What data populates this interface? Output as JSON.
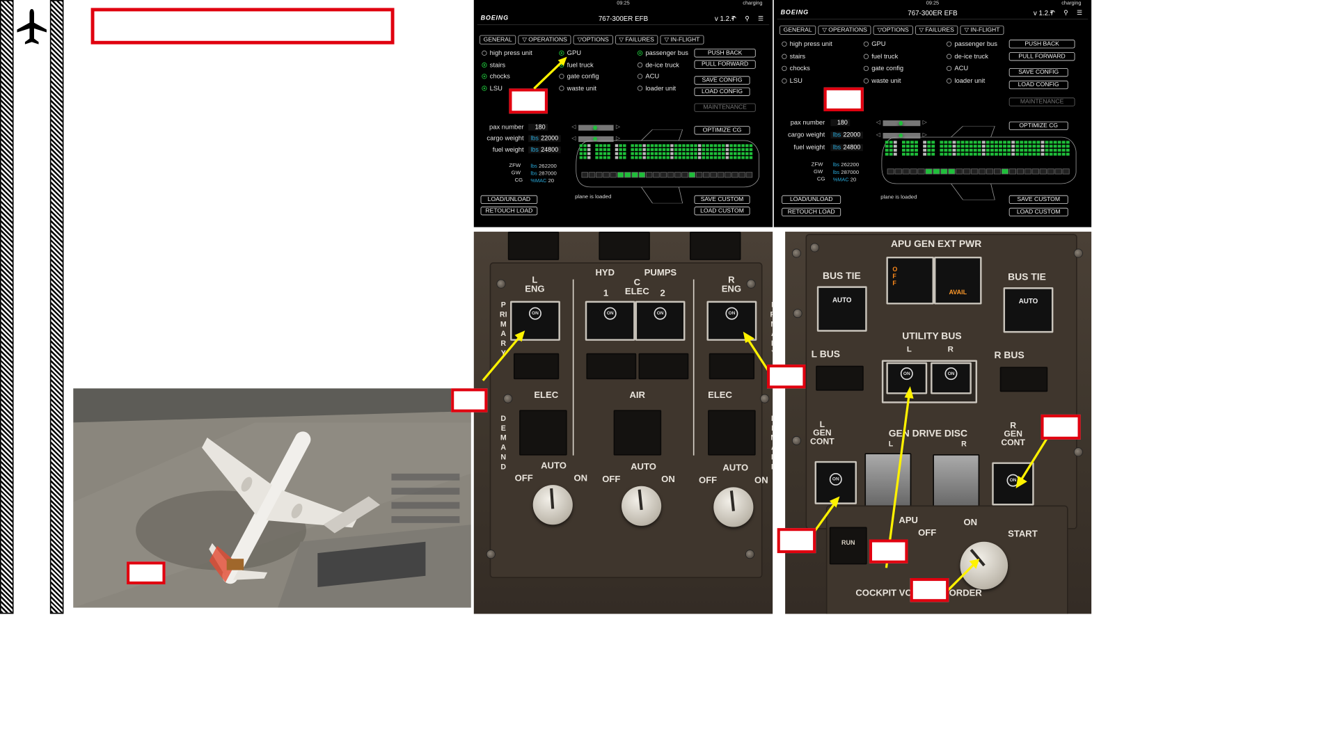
{
  "sidebar": {
    "icon": "airplane-icon"
  },
  "efb_left": {
    "time": "09:25",
    "charging": "charging",
    "logo": "BOEING",
    "title": "767-300ER EFB",
    "version": "v 1.2.7",
    "tabs": [
      "GENERAL",
      "▽ OPERATIONS",
      "▽OPTIONS",
      "▽ FAILURES",
      "▽ IN-FLIGHT"
    ],
    "col1": [
      {
        "label": "high press unit",
        "on": false
      },
      {
        "label": "stairs",
        "on": true
      },
      {
        "label": "chocks",
        "on": true
      },
      {
        "label": "LSU",
        "on": true
      }
    ],
    "col2": [
      {
        "label": "GPU",
        "on": true
      },
      {
        "label": "fuel truck",
        "on": true
      },
      {
        "label": "gate config",
        "on": false
      },
      {
        "label": "waste unit",
        "on": false
      }
    ],
    "col3": [
      {
        "label": "passenger bus",
        "on": true
      },
      {
        "label": "de-ice truck",
        "on": false
      },
      {
        "label": "ACU",
        "on": false
      },
      {
        "label": "loader unit",
        "on": false
      }
    ],
    "buttons": {
      "push_back": "PUSH BACK",
      "pull_forward": "PULL FORWARD",
      "save_config": "SAVE CONFIG",
      "load_config": "LOAD CONFIG",
      "maintenance": "MAINTENANCE",
      "optimize_cg": "OPTIMIZE CG",
      "load_unload": "LOAD/UNLOAD",
      "retouch_load": "RETOUCH LOAD",
      "save_custom": "SAVE CUSTOM",
      "load_custom": "LOAD CUSTOM"
    },
    "pax_label": "pax number",
    "pax_value": "180",
    "cargo_label": "cargo weight",
    "cargo_unit": "lbs",
    "cargo_value": "22000",
    "fuel_label": "fuel weight",
    "fuel_unit": "lbs",
    "fuel_value": "24800",
    "zfw_label": "ZFW",
    "zfw_unit": "lbs",
    "zfw_value": "262200",
    "gw_label": "GW",
    "gw_unit": "lbs",
    "gw_value": "287000",
    "cg_label": "CG",
    "cg_unit": "%MAC",
    "cg_value": "20",
    "plane_status": "plane is loaded"
  },
  "efb_right": {
    "time": "09:25",
    "charging": "charging",
    "logo": "BOEING",
    "title": "767-300ER EFB",
    "version": "v 1.2.7",
    "tabs": [
      "GENERAL",
      "▽ OPERATIONS",
      "▽OPTIONS",
      "▽ FAILURES",
      "▽ IN-FLIGHT"
    ],
    "col1": [
      {
        "label": "high press unit",
        "on": false
      },
      {
        "label": "stairs",
        "on": false
      },
      {
        "label": "chocks",
        "on": false
      },
      {
        "label": "LSU",
        "on": false
      }
    ],
    "col2": [
      {
        "label": "GPU",
        "on": false
      },
      {
        "label": "fuel truck",
        "on": false
      },
      {
        "label": "gate config",
        "on": false
      },
      {
        "label": "waste unit",
        "on": false
      }
    ],
    "col3": [
      {
        "label": "passenger bus",
        "on": false
      },
      {
        "label": "de-ice truck",
        "on": false
      },
      {
        "label": "ACU",
        "on": false
      },
      {
        "label": "loader unit",
        "on": false
      }
    ],
    "buttons": {
      "push_back": "PUSH BACK",
      "pull_forward": "PULL FORWARD",
      "save_config": "SAVE CONFIG",
      "load_config": "LOAD CONFIG",
      "maintenance": "MAINTENANCE",
      "optimize_cg": "OPTIMIZE CG",
      "load_unload": "LOAD/UNLOAD",
      "retouch_load": "RETOUCH LOAD",
      "save_custom": "SAVE CUSTOM",
      "load_custom": "LOAD CUSTOM"
    },
    "pax_label": "pax number",
    "pax_value": "180",
    "cargo_label": "cargo weight",
    "cargo_unit": "lbs",
    "cargo_value": "22000",
    "fuel_label": "fuel weight",
    "fuel_unit": "lbs",
    "fuel_value": "24800",
    "zfw_label": "ZFW",
    "zfw_unit": "lbs",
    "zfw_value": "262200",
    "gw_label": "GW",
    "gw_unit": "lbs",
    "gw_value": "287000",
    "cg_label": "CG",
    "cg_unit": "%MAC",
    "cg_value": "20",
    "plane_status": "plane is loaded"
  },
  "hyd_panel": {
    "hyd": "HYD",
    "pumps": "PUMPS",
    "l_eng": "L\nENG",
    "r_eng": "R\nENG",
    "c_elec": "C\nELEC",
    "one": "1",
    "two": "2",
    "primary": "PRIMARY",
    "demand": "DEMAND",
    "elec": "ELEC",
    "air": "AIR",
    "on": "ON",
    "auto": "AUTO",
    "off": "OFF"
  },
  "elec_panel": {
    "apu_gen_ext_pwr": "APU GEN EXT PWR",
    "bus_tie": "BUS TIE",
    "auto": "AUTO",
    "off": "OFF",
    "avail": "AVAIL",
    "utility_bus": "UTILITY BUS",
    "l": "L",
    "r": "R",
    "l_bus": "L BUS",
    "r_bus": "R BUS",
    "l_gen_cont": "L\nGEN\nCONT",
    "r_gen_cont": "R\nGEN\nCONT",
    "gen_drive_disc": "GEN DRIVE DISC",
    "apu": "APU",
    "apu_off": "OFF",
    "apu_on": "ON",
    "apu_start": "START",
    "run": "RUN",
    "cockpit_voice": "COCKPIT VOICE RECORDER",
    "on": "ON"
  }
}
